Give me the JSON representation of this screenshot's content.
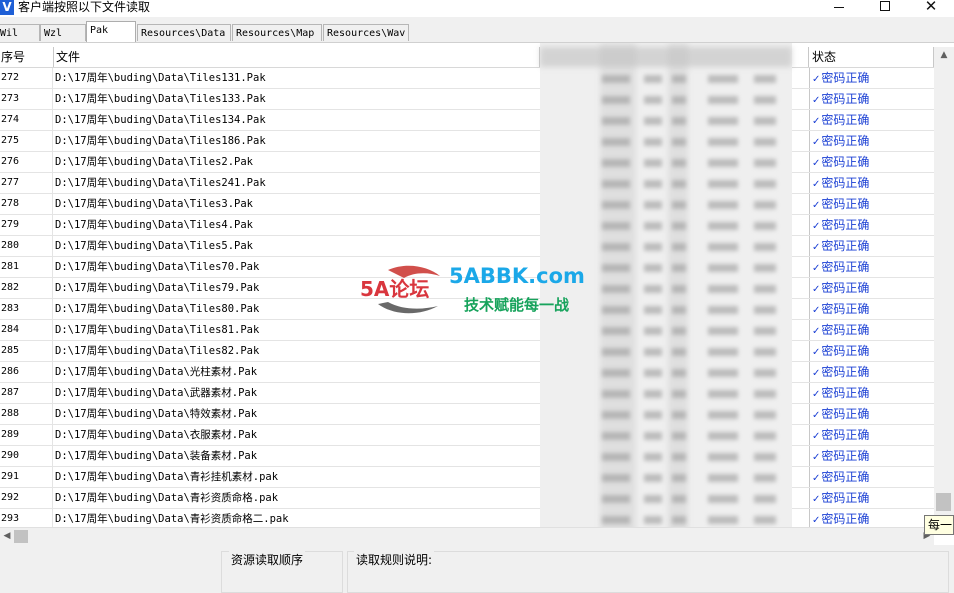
{
  "window": {
    "icon_letter": "V",
    "title": "客户端按照以下文件读取",
    "controls": {
      "minimize": "—",
      "maximize": "☐",
      "close": "✕"
    }
  },
  "tabs": [
    {
      "label": "Wil",
      "active": false
    },
    {
      "label": "Wzl",
      "active": false
    },
    {
      "label": "Pak",
      "active": true
    },
    {
      "label": "Resources\\Data",
      "active": false
    },
    {
      "label": "Resources\\Map",
      "active": false
    },
    {
      "label": "Resources\\Wav",
      "active": false
    }
  ],
  "grid": {
    "columns": {
      "index": "序号",
      "file": "文件",
      "status": "状态"
    },
    "rows": [
      {
        "index": "272",
        "file": "D:\\17周年\\buding\\Data\\Tiles131.Pak",
        "status": "密码正确"
      },
      {
        "index": "273",
        "file": "D:\\17周年\\buding\\Data\\Tiles133.Pak",
        "status": "密码正确"
      },
      {
        "index": "274",
        "file": "D:\\17周年\\buding\\Data\\Tiles134.Pak",
        "status": "密码正确"
      },
      {
        "index": "275",
        "file": "D:\\17周年\\buding\\Data\\Tiles186.Pak",
        "status": "密码正确"
      },
      {
        "index": "276",
        "file": "D:\\17周年\\buding\\Data\\Tiles2.Pak",
        "status": "密码正确"
      },
      {
        "index": "277",
        "file": "D:\\17周年\\buding\\Data\\Tiles241.Pak",
        "status": "密码正确"
      },
      {
        "index": "278",
        "file": "D:\\17周年\\buding\\Data\\Tiles3.Pak",
        "status": "密码正确"
      },
      {
        "index": "279",
        "file": "D:\\17周年\\buding\\Data\\Tiles4.Pak",
        "status": "密码正确"
      },
      {
        "index": "280",
        "file": "D:\\17周年\\buding\\Data\\Tiles5.Pak",
        "status": "密码正确"
      },
      {
        "index": "281",
        "file": "D:\\17周年\\buding\\Data\\Tiles70.Pak",
        "status": "密码正确"
      },
      {
        "index": "282",
        "file": "D:\\17周年\\buding\\Data\\Tiles79.Pak",
        "status": "密码正确"
      },
      {
        "index": "283",
        "file": "D:\\17周年\\buding\\Data\\Tiles80.Pak",
        "status": "密码正确"
      },
      {
        "index": "284",
        "file": "D:\\17周年\\buding\\Data\\Tiles81.Pak",
        "status": "密码正确"
      },
      {
        "index": "285",
        "file": "D:\\17周年\\buding\\Data\\Tiles82.Pak",
        "status": "密码正确"
      },
      {
        "index": "286",
        "file": "D:\\17周年\\buding\\Data\\光柱素材.Pak",
        "status": "密码正确"
      },
      {
        "index": "287",
        "file": "D:\\17周年\\buding\\Data\\武器素材.Pak",
        "status": "密码正确"
      },
      {
        "index": "288",
        "file": "D:\\17周年\\buding\\Data\\特效素材.Pak",
        "status": "密码正确"
      },
      {
        "index": "289",
        "file": "D:\\17周年\\buding\\Data\\衣服素材.Pak",
        "status": "密码正确"
      },
      {
        "index": "290",
        "file": "D:\\17周年\\buding\\Data\\装备素材.Pak",
        "status": "密码正确"
      },
      {
        "index": "291",
        "file": "D:\\17周年\\buding\\Data\\青衫挂机素材.pak",
        "status": "密码正确"
      },
      {
        "index": "292",
        "file": "D:\\17周年\\buding\\Data\\青衫资质命格.pak",
        "status": "密码正确"
      },
      {
        "index": "293",
        "file": "D:\\17周年\\buding\\Data\\青衫资质命格二.pak",
        "status": "密码正确"
      }
    ],
    "status_color": "#1a3fd4",
    "status_icon": "check-icon"
  },
  "watermark": {
    "main": "5ABBK.com",
    "sub": "技术赋能每一战",
    "logo_text": "5A论坛"
  },
  "tooltip": {
    "text": "每一"
  },
  "bottom": {
    "load_order_title": "资源读取顺序",
    "rules_title": "读取规则说明:"
  }
}
